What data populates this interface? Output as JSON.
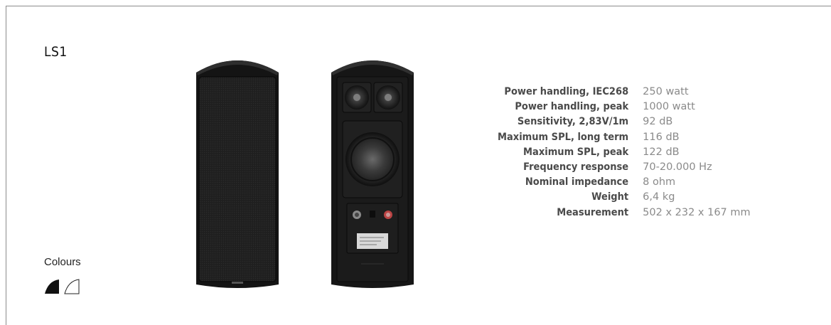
{
  "product": {
    "name": "LS1"
  },
  "colours": {
    "label": "Colours",
    "options": [
      "black",
      "white"
    ],
    "accent": "#111111"
  },
  "specs": [
    {
      "label": "Power handling, IEC268",
      "value": "250 watt"
    },
    {
      "label": "Power handling, peak",
      "value": "1000 watt"
    },
    {
      "label": "Sensitivity, 2,83V/1m",
      "value": "92 dB"
    },
    {
      "label": "Maximum SPL, long term",
      "value": "116 dB"
    },
    {
      "label": "Maximum SPL, peak",
      "value": "122 dB"
    },
    {
      "label": "Frequency response",
      "value": "70-20.000 Hz"
    },
    {
      "label": "Nominal impedance",
      "value": "8 ohm"
    },
    {
      "label": "Weight",
      "value": "6,4 kg"
    },
    {
      "label": "Measurement",
      "value": "502 x 232 x 167 mm"
    }
  ]
}
